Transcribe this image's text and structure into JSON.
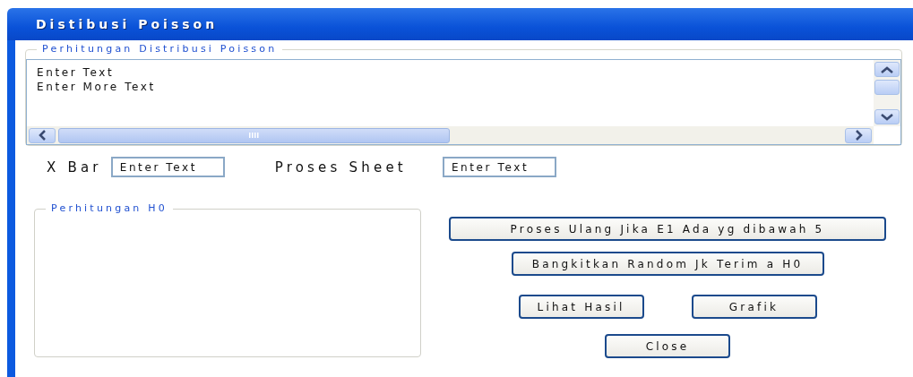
{
  "window": {
    "title": "Distibusi Poisson"
  },
  "calc_group": {
    "title": "Perhitungan Distribusi Poisson",
    "lines": [
      "Enter Text",
      "Enter More Text"
    ]
  },
  "fields": [
    {
      "label": "X Bar",
      "value": "Enter Text"
    },
    {
      "label": "Proses Sheet",
      "value": "Enter Text"
    }
  ],
  "h0_group": {
    "title": "Perhitungan H0"
  },
  "buttons": [
    {
      "label": "Proses Ulang Jika E1 Ada yg dibawah 5",
      "kind": "wide"
    },
    {
      "label": "Bangkitkan Random Jk Terim a H0",
      "kind": "medium"
    },
    {
      "label": "Lihat Hasil",
      "kind": "small"
    },
    {
      "label": "Grafik",
      "kind": "small"
    },
    {
      "label": "Close",
      "kind": "small"
    }
  ]
}
